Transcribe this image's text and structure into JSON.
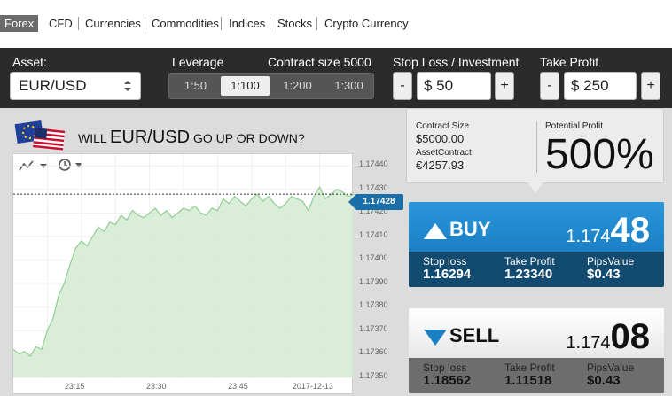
{
  "nav": {
    "tabs": [
      "Forex",
      "CFD",
      "Currencies",
      "Commodities",
      "Indices",
      "Stocks",
      "Crypto Currency"
    ],
    "active": "Forex"
  },
  "controls": {
    "asset_label": "Asset:",
    "asset_value": "EUR/USD",
    "leverage_label": "Leverage",
    "leverage_options": [
      "1:50",
      "1:100",
      "1:200",
      "1:300"
    ],
    "leverage_selected": "1:100",
    "contract_size_label": "Contract size",
    "contract_size_value": "5000",
    "stop_loss_label": "Stop Loss / Investment",
    "stop_loss_value": "$ 50",
    "take_profit_label": "Take Profit",
    "take_profit_value": "$ 250",
    "minus": "-",
    "plus": "+"
  },
  "question": {
    "prefix": "WILL",
    "asset": "EUR/USD",
    "suffix": "GO UP OR DOWN?"
  },
  "info": {
    "contract_size_label": "Contract Size",
    "contract_size_value": "$5000.00",
    "asset_contract_label": "AssetContract",
    "asset_contract_value": "€4257.93",
    "potential_profit_label": "Potential Profit",
    "potential_profit_value": "500%"
  },
  "buy": {
    "label": "BUY",
    "price_prefix": "1.174",
    "price_big": "48",
    "stop_loss_label": "Stop loss",
    "stop_loss_value": "1.16294",
    "take_profit_label": "Take Profit",
    "take_profit_value": "1.23340",
    "pips_label": "PipsValue",
    "pips_value": "$0.43"
  },
  "sell": {
    "label": "SELL",
    "price_prefix": "1.174",
    "price_big": "08",
    "stop_loss_label": "Stop loss",
    "stop_loss_value": "1.18562",
    "take_profit_label": "Take Profit",
    "take_profit_value": "1.11518",
    "pips_label": "PipsValue",
    "pips_value": "$0.43"
  },
  "colors": {
    "buy": "#1b7fc4",
    "sell": "#6d6d6d",
    "area_fill": "#cfe9cf",
    "area_line": "#8fcf8f"
  },
  "chart_data": {
    "type": "area",
    "current_price": "1.17428",
    "y_ticks": [
      "1.17440",
      "1.17430",
      "1.17420",
      "1.17410",
      "1.17400",
      "1.17390",
      "1.17380",
      "1.17370",
      "1.17360",
      "1.17350"
    ],
    "ylim": [
      1.1735,
      1.17445
    ],
    "x_ticks": [
      "23:15",
      "23:30",
      "23:45",
      "2017-12-13"
    ],
    "x_tick_positions": [
      0.18,
      0.42,
      0.66,
      0.88
    ],
    "values": [
      1.17362,
      1.1736,
      1.17361,
      1.17359,
      1.17363,
      1.17362,
      1.1737,
      1.17375,
      1.17385,
      1.1739,
      1.17398,
      1.17405,
      1.17408,
      1.17406,
      1.1741,
      1.17414,
      1.17412,
      1.17416,
      1.17415,
      1.17419,
      1.17417,
      1.17421,
      1.17419,
      1.17418,
      1.1742,
      1.17422,
      1.17419,
      1.17421,
      1.17418,
      1.1742,
      1.17422,
      1.17421,
      1.17423,
      1.1742,
      1.17419,
      1.17422,
      1.17421,
      1.17426,
      1.17424,
      1.17427,
      1.17425,
      1.17423,
      1.17426,
      1.17428,
      1.17425,
      1.17427,
      1.17424,
      1.17422,
      1.17424,
      1.17427,
      1.17426,
      1.17425,
      1.17421,
      1.17427,
      1.17431,
      1.17426,
      1.17428,
      1.1743,
      1.17429,
      1.17427,
      1.17428
    ]
  }
}
